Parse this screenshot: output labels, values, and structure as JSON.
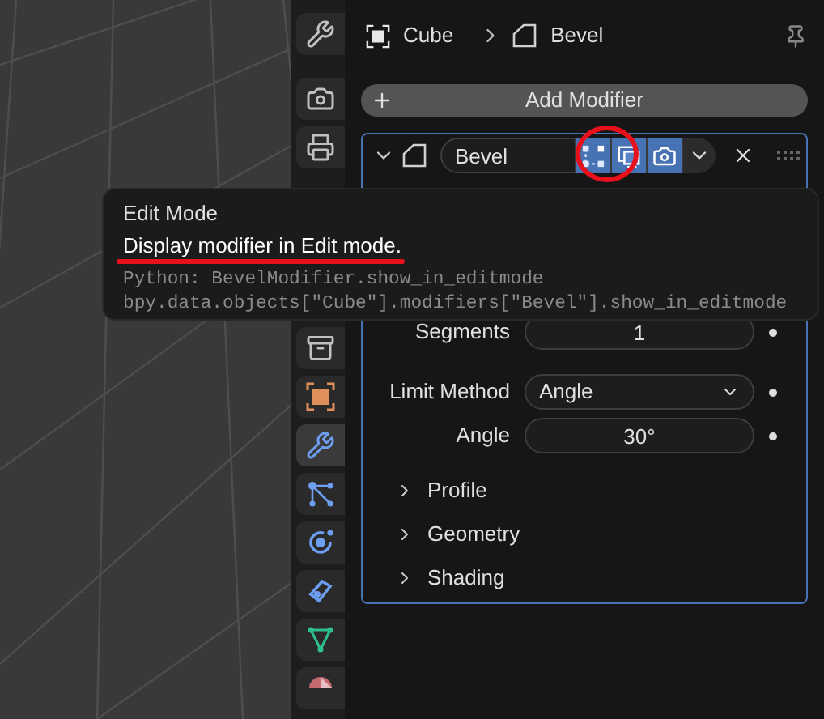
{
  "breadcrumb": [
    {
      "label": "Cube"
    },
    {
      "label": "Bevel"
    }
  ],
  "tab_groups": [
    {
      "tabs": [
        {
          "kind": "tool",
          "selected": false
        }
      ]
    },
    {
      "tabs": [
        {
          "kind": "render",
          "selected": false
        },
        {
          "kind": "output",
          "selected": false
        }
      ]
    },
    {
      "tabs": [
        {
          "kind": "collection",
          "selected": false
        },
        {
          "kind": "object",
          "selected": false
        },
        {
          "kind": "modifiers",
          "selected": true
        },
        {
          "kind": "particles",
          "selected": false
        },
        {
          "kind": "physics",
          "selected": false
        },
        {
          "kind": "constraints",
          "selected": false
        },
        {
          "kind": "data",
          "selected": false
        },
        {
          "kind": "material",
          "selected": false
        }
      ]
    }
  ],
  "add_modifier": "Add Modifier",
  "modifier": {
    "name": "Bevel",
    "expanded": true,
    "toggles": [
      {
        "kind": "editmode",
        "on": true
      },
      {
        "kind": "viewport",
        "on": true
      },
      {
        "kind": "render",
        "on": true
      }
    ],
    "fields": [
      {
        "label": "Segments",
        "kind": "number",
        "value": "1"
      },
      {
        "label": "Limit Method",
        "kind": "dropdown",
        "value": "Angle"
      },
      {
        "label": "Angle",
        "kind": "number",
        "value": "30°"
      }
    ],
    "subpanels": [
      {
        "label": "Profile",
        "expanded": false
      },
      {
        "label": "Geometry",
        "expanded": false
      },
      {
        "label": "Shading",
        "expanded": false
      }
    ]
  },
  "tooltip": {
    "title": "Edit Mode",
    "description": "Display modifier in Edit mode.",
    "python": [
      "Python: BevelModifier.show_in_editmode",
      "bpy.data.objects[\"Cube\"].modifiers[\"Bevel\"].show_in_editmode"
    ]
  }
}
